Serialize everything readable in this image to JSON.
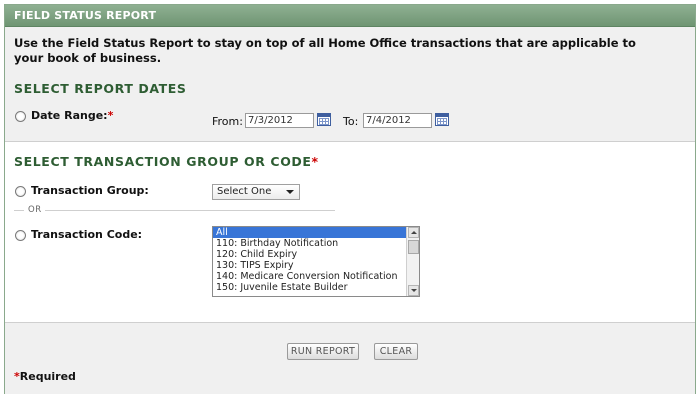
{
  "panel": {
    "title": "FIELD STATUS REPORT"
  },
  "intro": {
    "text": "Use the Field Status Report to stay on top of all Home Office transactions that are applicable to your book of business."
  },
  "report_dates": {
    "title": "SELECT REPORT DATES",
    "date_range_label": "Date Range:",
    "required_mark": "*",
    "from_label": "From:",
    "from_value": "7/3/2012",
    "to_label": "To:",
    "to_value": "7/4/2012"
  },
  "transaction": {
    "title": "SELECT TRANSACTION GROUP OR CODE",
    "required_mark": "*",
    "group_label": "Transaction Group:",
    "group_select": "Select One",
    "or_text": "OR",
    "code_label": "Transaction Code:",
    "code_options": [
      "All",
      "110: Birthday Notification",
      "120: Child Expiry",
      "130: TIPS Expiry",
      "140: Medicare Conversion Notification",
      "150: Juvenile Estate Builder"
    ],
    "selected_index": 0
  },
  "actions": {
    "run_report": "RUN REPORT",
    "clear": "CLEAR"
  },
  "footer": {
    "required_mark": "*",
    "required_text": "Required"
  },
  "colors": {
    "header": "#7a9f7e",
    "section_title": "#2e5d33",
    "required": "#cc0000",
    "selection": "#3875d7"
  }
}
